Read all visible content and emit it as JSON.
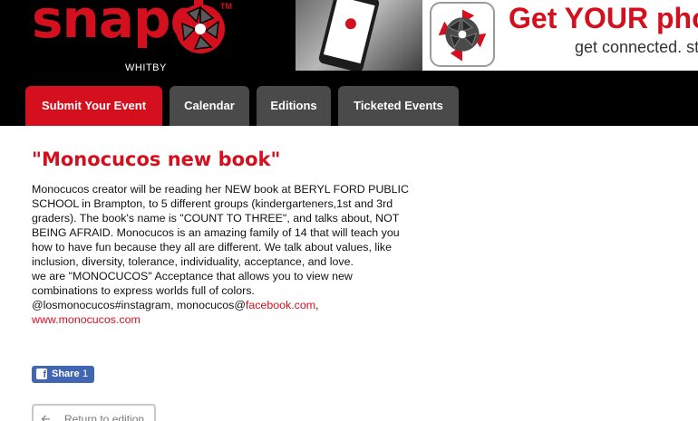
{
  "header": {
    "brand": "snapd",
    "trademark": "TM",
    "city": "WHITBY",
    "brand_color": "#d4101f",
    "banner": {
      "phone_app_name": "snapd",
      "line1": "Get YOUR photo",
      "line2": "get connected. st"
    }
  },
  "nav": {
    "tabs": [
      {
        "label": "Submit Your Event",
        "active": true
      },
      {
        "label": "Calendar",
        "active": false
      },
      {
        "label": "Editions",
        "active": false
      },
      {
        "label": "Ticketed Events",
        "active": false
      }
    ]
  },
  "event": {
    "title": "\"Monocucos new book\"",
    "paragraph1": "Monocucos creator will be reading her NEW book at BERYL FORD PUBLIC SCHOOL in Brampton, to 5 different groups (kindergarteners,1st and 3rd graders). The book's name is \"COUNT TO THREE\", and talks about, NOT BEING AFRAID. Monocucos is an amazing family of 14 that will teach you how to have fun because they all are different. We talk about values, like inclusion, diversity, tolerance, individuality, acceptance, and love.",
    "paragraph2": "we are \"MONOCUCOS\" Acceptance that allows you to view new combinations to express worlds full of colors.",
    "social_prefix": "@losmonocucos#instagram, monocucos@",
    "social_link": "facebook.com",
    "social_suffix": ",",
    "website": "www.monocucos.com"
  },
  "share": {
    "icon": "facebook-icon",
    "label": "Share",
    "count": "1"
  },
  "return_button": {
    "icon": "arrow-left-icon",
    "label": "Return to edition"
  }
}
